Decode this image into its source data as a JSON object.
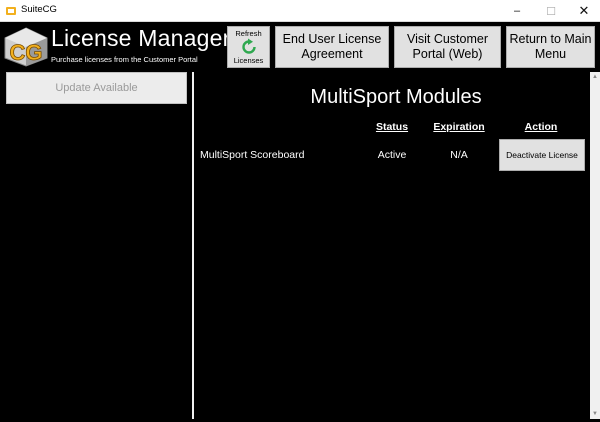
{
  "window": {
    "title": "SuiteCG",
    "controls": {
      "minimize": "–",
      "maximize": "☐",
      "close": "✕"
    }
  },
  "header": {
    "title": "License Manager",
    "subtitle": "Purchase licenses from the Customer Portal",
    "logo_text": "CG",
    "refresh": {
      "top": "Refresh",
      "bottom": "Licenses",
      "icon": "refresh-icon",
      "icon_color": "#2fa84f"
    },
    "eula_label": "End User License Agreement",
    "portal_label": "Visit Customer Portal (Web)",
    "return_label": "Return to Main Menu"
  },
  "sidebar": {
    "update_label": "Update Available"
  },
  "main": {
    "title": "MultiSport Modules",
    "columns": {
      "status": "Status",
      "expiration": "Expiration",
      "action": "Action"
    },
    "rows": [
      {
        "name": "MultiSport Scoreboard",
        "status": "Active",
        "expiration": "N/A",
        "action": "Deactivate License"
      }
    ]
  },
  "colors": {
    "background": "#000000",
    "button": "#e1e1e1",
    "logo_gold": "#f2b01e"
  }
}
